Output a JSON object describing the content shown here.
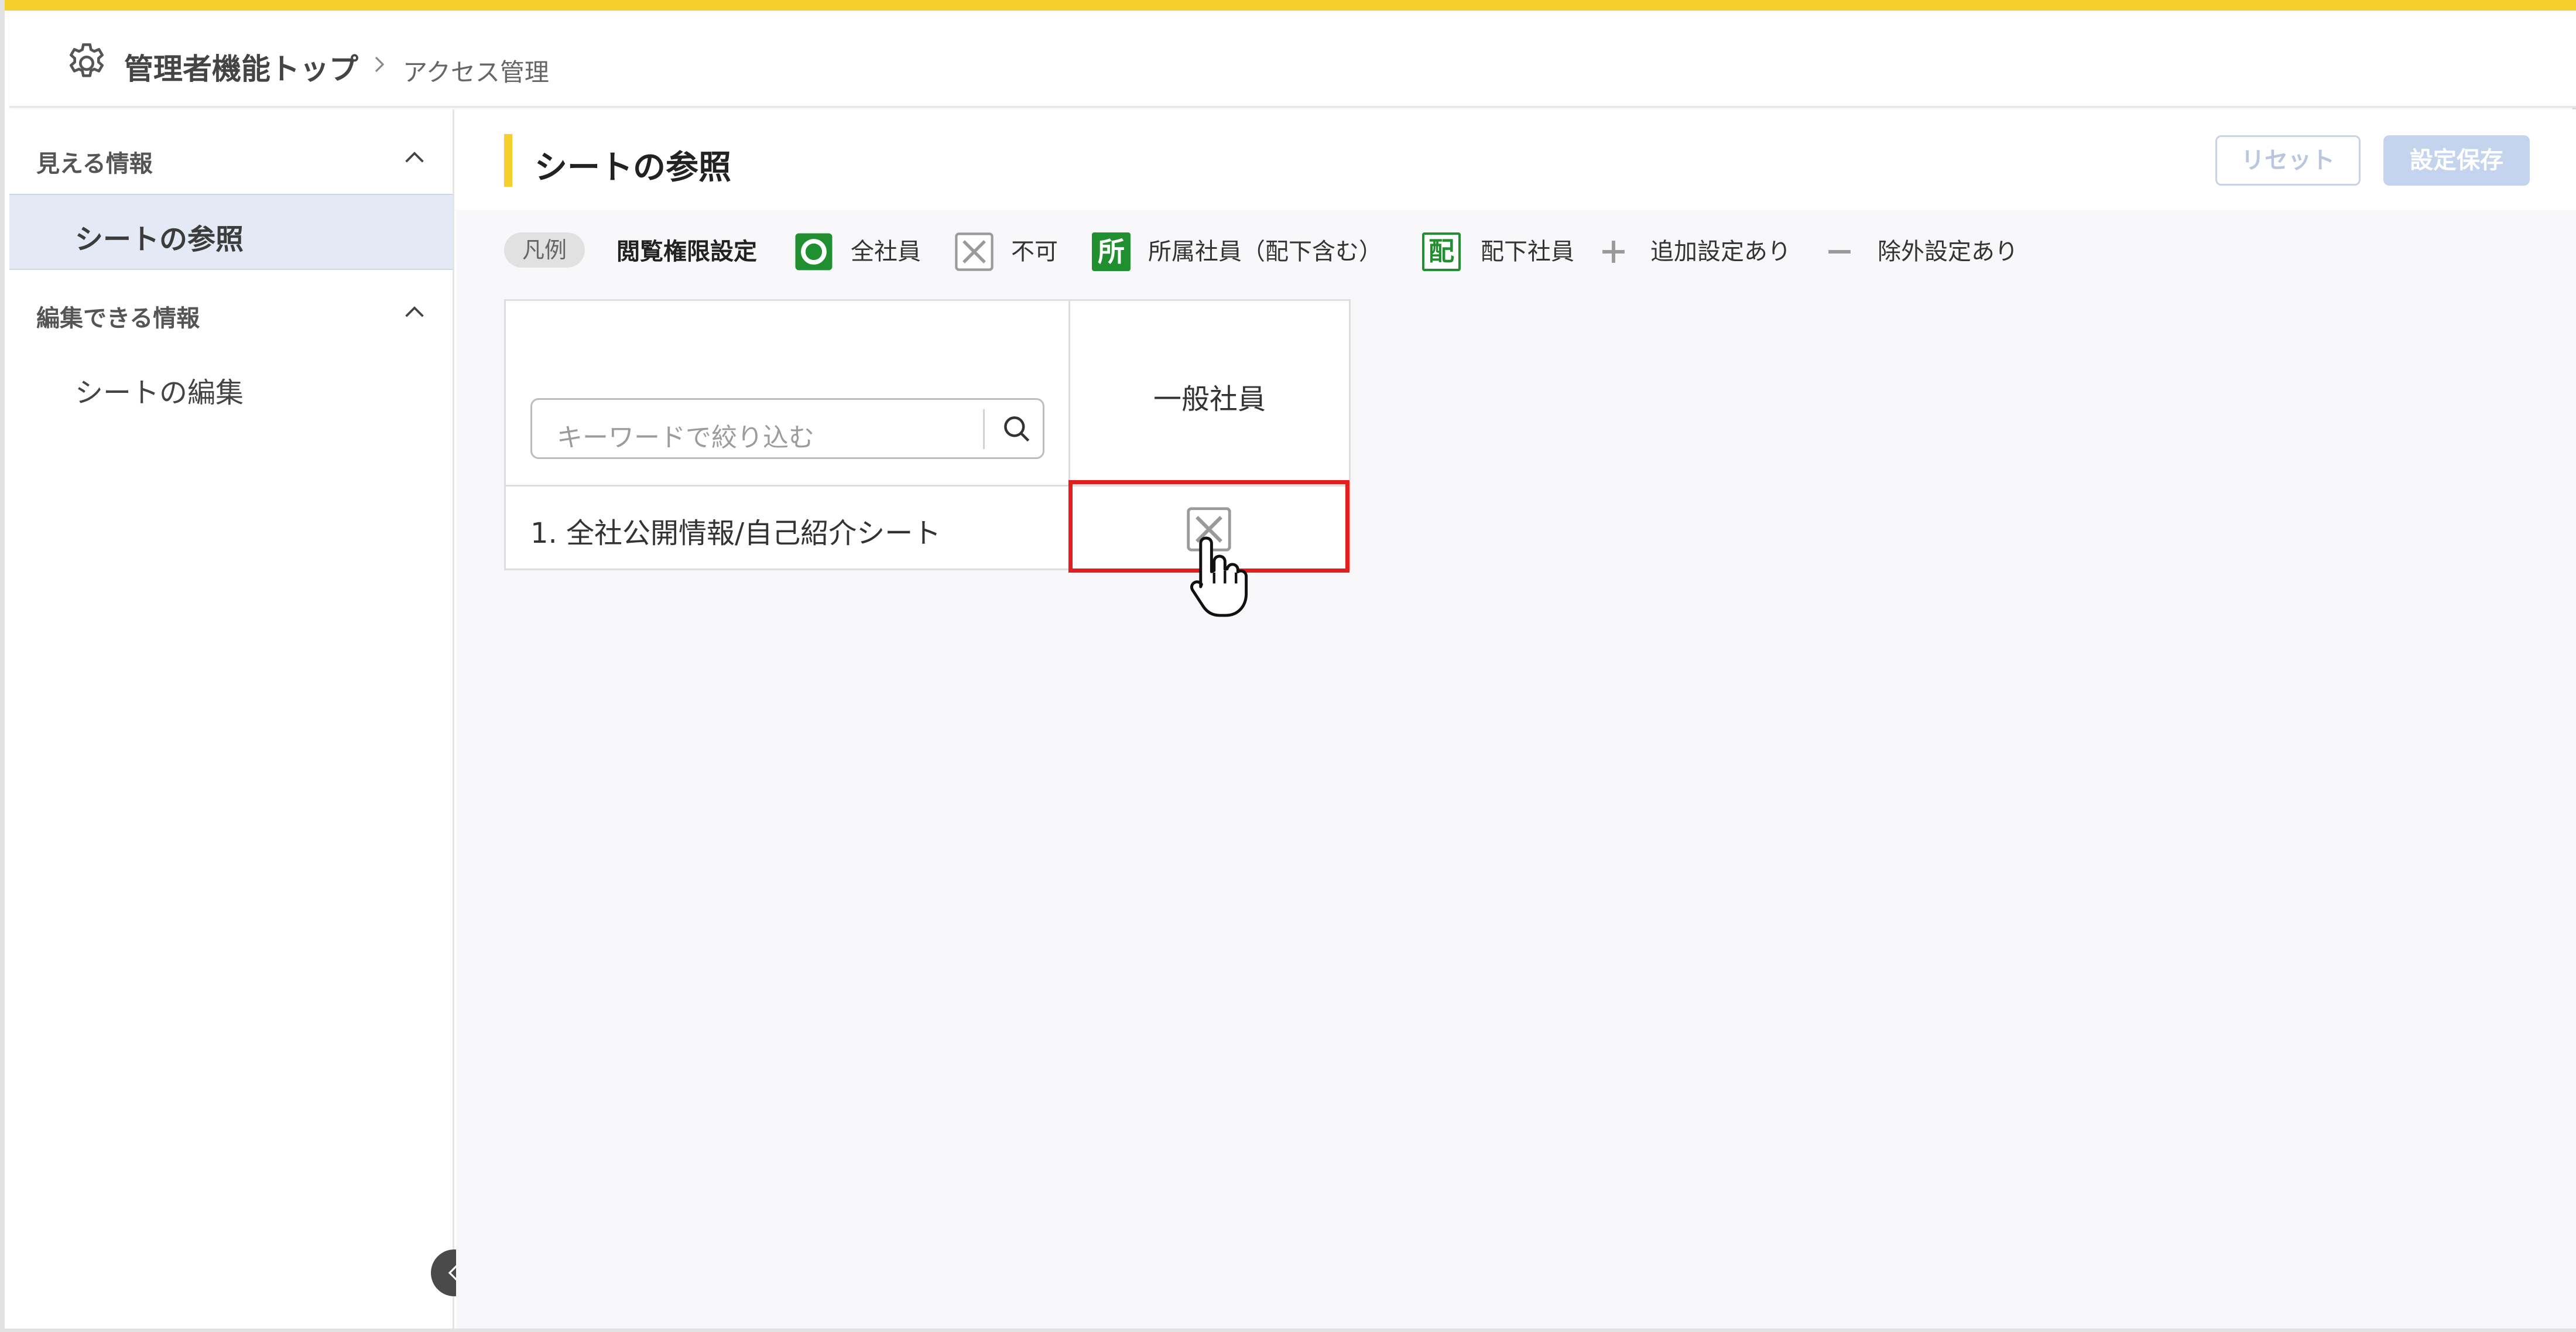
{
  "header": {
    "breadcrumb_main": "管理者機能トップ",
    "breadcrumb_current": "アクセス管理"
  },
  "sidebar": {
    "sections": [
      {
        "title": "見える情報",
        "items": [
          {
            "label": "シートの参照",
            "active": true
          }
        ]
      },
      {
        "title": "編集できる情報",
        "items": [
          {
            "label": "シートの編集",
            "active": false
          }
        ]
      }
    ]
  },
  "main": {
    "title": "シートの参照",
    "reset_label": "リセット",
    "save_label": "設定保存"
  },
  "legend": {
    "badge": "凡例",
    "heading": "閲覧権限設定",
    "items": [
      {
        "icon": "all-employees-icon",
        "label": "全社員"
      },
      {
        "icon": "not-allowed-icon",
        "label": "不可"
      },
      {
        "icon": "affiliated-icon",
        "icon_char": "所",
        "label": "所属社員（配下含む）"
      },
      {
        "icon": "subordinate-icon",
        "icon_char": "配",
        "label": "配下社員"
      },
      {
        "icon": "plus-icon",
        "label": "追加設定あり"
      },
      {
        "icon": "minus-icon",
        "label": "除外設定あり"
      }
    ]
  },
  "matrix": {
    "search_placeholder": "キーワードで絞り込む",
    "column_title": "一般社員",
    "rows": [
      {
        "label": "1. 全社公開情報/自己紹介シート",
        "permission": "不可"
      }
    ]
  },
  "colors": {
    "accent": "#f7cf2d",
    "permission_green": "#1f8f2f",
    "highlight": "#e41d1d",
    "primary_disabled": "#c4d3ee"
  }
}
